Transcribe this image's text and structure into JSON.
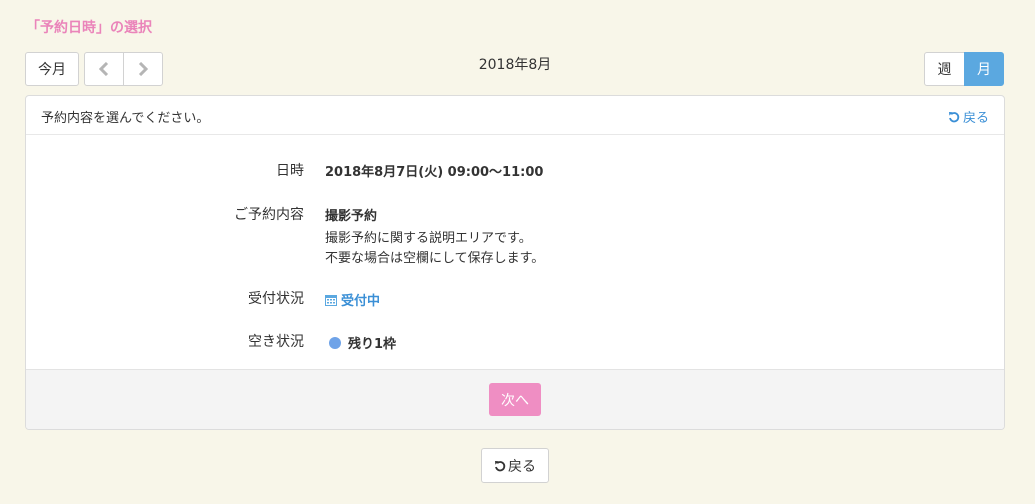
{
  "page": {
    "title": "「予約日時」の選択"
  },
  "toolbar": {
    "today_label": "今月",
    "prev_icon": "chevron-left-icon",
    "next_icon": "chevron-right-icon",
    "calendar_title": "2018年8月",
    "week_label": "週",
    "month_label": "月",
    "active_view": "月"
  },
  "panel": {
    "instruction": "予約内容を選んでください。",
    "back_label": "戻る",
    "rows": {
      "datetime": {
        "label": "日時",
        "value": "2018年8月7日(火) 09:00〜11:00"
      },
      "content": {
        "label": "ご予約内容",
        "name": "撮影予約",
        "desc_line1": "撮影予約に関する説明エリアです。",
        "desc_line2": "不要な場合は空欄にして保存します。"
      },
      "status": {
        "label": "受付状況",
        "value": "受付中",
        "icon": "calendar-icon"
      },
      "availability": {
        "label": "空き状況",
        "value": "残り1枠",
        "icon": "circle-dot-icon"
      }
    },
    "next_label": "次へ"
  },
  "footer": {
    "back_label": "戻る"
  },
  "colors": {
    "background": "#f8f6e9",
    "title_pink": "#ea84ba",
    "accent_blue": "#5ba8e0",
    "link_blue": "#3a8fd6",
    "next_button": "#ef8ec3",
    "availability_dot": "#6fa3e8"
  }
}
